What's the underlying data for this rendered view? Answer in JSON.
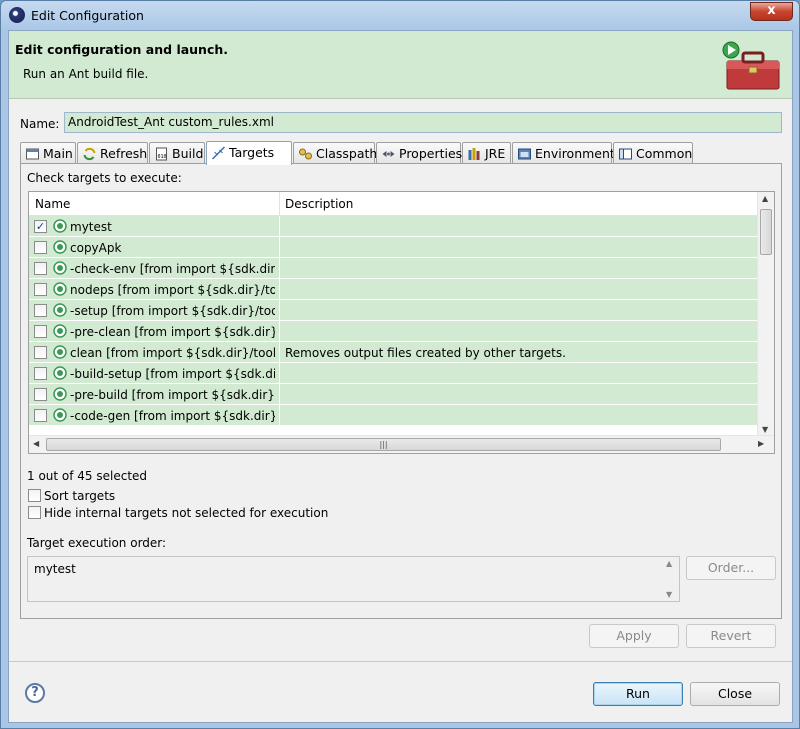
{
  "window": {
    "title": "Edit Configuration",
    "close_label": "x"
  },
  "banner": {
    "title": "Edit configuration and launch.",
    "message": "Run an Ant build file."
  },
  "name_field": {
    "label": "Name:",
    "value": "AndroidTest_Ant custom_rules.xml"
  },
  "tabs": [
    {
      "label": "Main",
      "icon": "main-tab-icon"
    },
    {
      "label": "Refresh",
      "icon": "refresh-tab-icon"
    },
    {
      "label": "Build",
      "icon": "build-tab-icon"
    },
    {
      "label": "Targets",
      "icon": "targets-tab-icon",
      "active": true
    },
    {
      "label": "Classpath",
      "icon": "classpath-tab-icon"
    },
    {
      "label": "Properties",
      "icon": "properties-tab-icon"
    },
    {
      "label": "JRE",
      "icon": "jre-tab-icon"
    },
    {
      "label": "Environment",
      "icon": "environment-tab-icon"
    },
    {
      "label": "Common",
      "icon": "common-tab-icon"
    }
  ],
  "targets": {
    "check_label": "Check targets to execute:",
    "columns": [
      "Name",
      "Description"
    ],
    "rows": [
      {
        "checked": true,
        "name": "mytest",
        "description": ""
      },
      {
        "checked": false,
        "name": "copyApk",
        "description": ""
      },
      {
        "checked": false,
        "name": "-check-env [from import ${sdk.dir}/tools/ant/build.xml]",
        "description": ""
      },
      {
        "checked": false,
        "name": "nodeps [from import ${sdk.dir}/tools/ant/build.xml]",
        "description": ""
      },
      {
        "checked": false,
        "name": "-setup [from import ${sdk.dir}/tools/ant/build.xml]",
        "description": ""
      },
      {
        "checked": false,
        "name": "-pre-clean [from import ${sdk.dir}/tools/ant/build.xml]",
        "description": ""
      },
      {
        "checked": false,
        "name": "clean [from import ${sdk.dir}/tools/ant/build.xml]",
        "description": "Removes output files created by other targets."
      },
      {
        "checked": false,
        "name": "-build-setup [from import ${sdk.dir}/tools/ant/build.xml]",
        "description": ""
      },
      {
        "checked": false,
        "name": "-pre-build [from import ${sdk.dir}/tools/ant/build.xml]",
        "description": ""
      },
      {
        "checked": false,
        "name": "-code-gen [from import ${sdk.dir}/tools/ant/build.xml]",
        "description": ""
      }
    ],
    "selected_count": "1 out of 45 selected",
    "sort_label": "Sort targets",
    "hide_internal_label": "Hide internal targets not selected for execution",
    "order_label": "Target execution order:",
    "order_value": "mytest",
    "order_button": "Order..."
  },
  "buttons": {
    "apply": "Apply",
    "revert": "Revert",
    "run": "Run",
    "close": "Close",
    "help": "?"
  },
  "colors": {
    "banner": "#d2ead2",
    "row_highlight": "#d2ead2",
    "title_bar": "#a9c6e6"
  }
}
